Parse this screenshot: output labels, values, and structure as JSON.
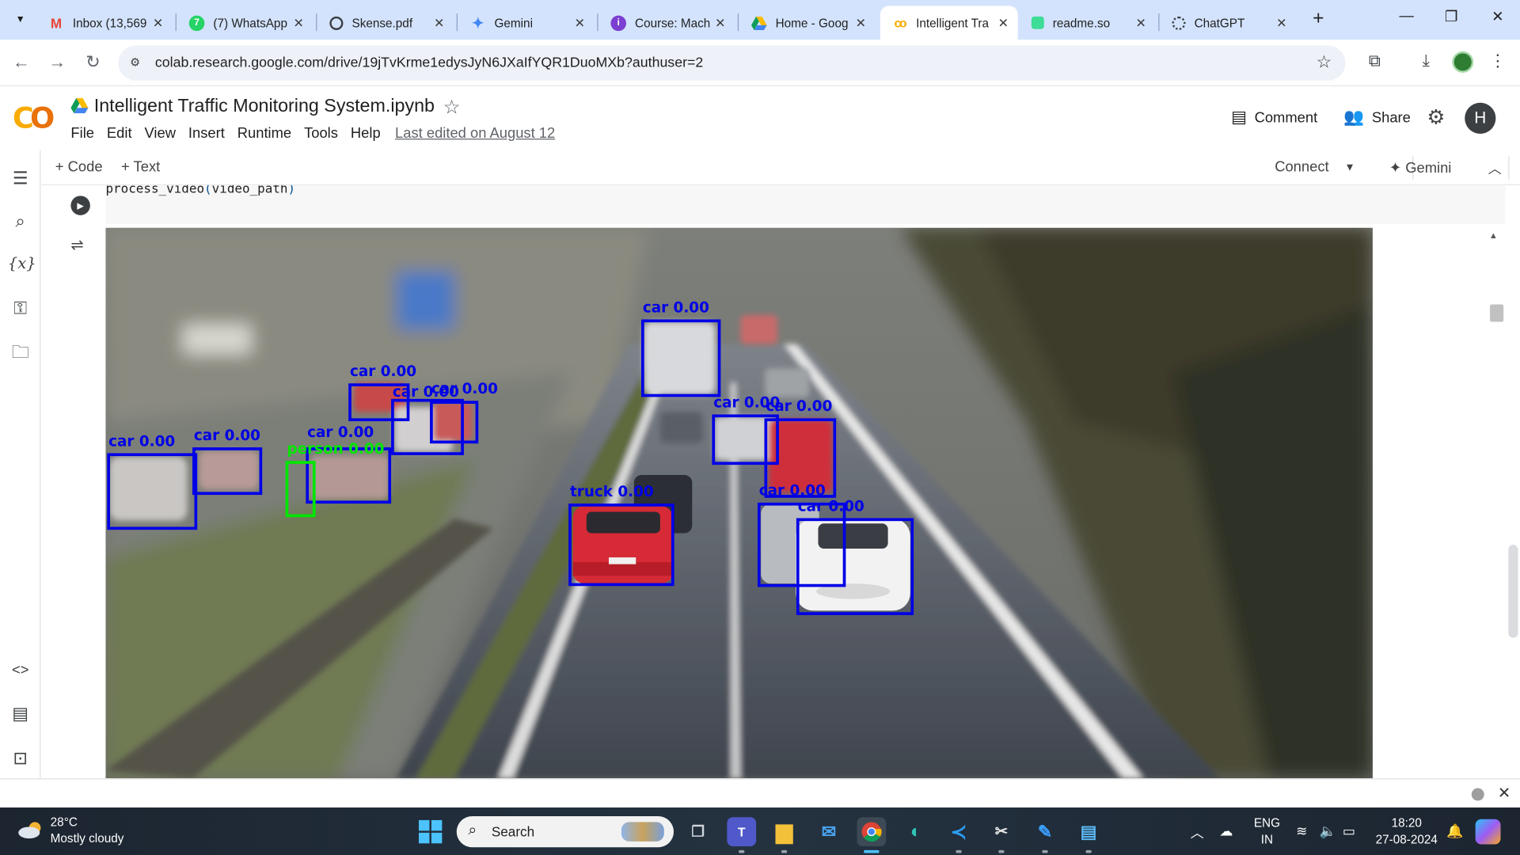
{
  "browser": {
    "tabs": [
      {
        "title": "Inbox (13,569",
        "icon": "gmail-icon",
        "active": false
      },
      {
        "title": "(7) WhatsApp",
        "icon": "whatsapp-icon",
        "active": false
      },
      {
        "title": "Skense.pdf",
        "icon": "globe-icon",
        "active": false
      },
      {
        "title": "Gemini",
        "icon": "gemini-icon",
        "active": false
      },
      {
        "title": "Course: Mach",
        "icon": "course-icon",
        "active": false
      },
      {
        "title": "Home - Goog",
        "icon": "drive-icon",
        "active": false
      },
      {
        "title": "Intelligent Tra",
        "icon": "colab-icon",
        "active": true
      },
      {
        "title": "readme.so",
        "icon": "readme-icon",
        "active": false
      },
      {
        "title": "ChatGPT",
        "icon": "chatgpt-icon",
        "active": false
      }
    ],
    "url": "colab.research.google.com/drive/19jTvKrme1edysJyN6JXaIfYQR1DuoMXb?authuser=2"
  },
  "colab": {
    "notebook_title": "Intelligent Traffic Monitoring System.ipynb",
    "menu": [
      "File",
      "Edit",
      "View",
      "Insert",
      "Runtime",
      "Tools",
      "Help"
    ],
    "last_edited": "Last edited on August 12",
    "comment_label": "Comment",
    "share_label": "Share",
    "avatar_letter": "H",
    "toolbar": {
      "code_label": "+ Code",
      "text_label": "+ Text",
      "connect_label": "Connect",
      "gemini_label": "Gemini"
    },
    "code_line": {
      "fn": "process_video",
      "arg": "video_path"
    }
  },
  "detections": [
    {
      "label": "car 0.00",
      "color": "#0000e6"
    },
    {
      "label": "car 0.00",
      "color": "#0000e6"
    },
    {
      "label": "car 0.00",
      "color": "#0000e6"
    },
    {
      "label": "car 0.00",
      "color": "#0000e6"
    },
    {
      "label": "car 0.00",
      "color": "#0000e6"
    },
    {
      "label": "car 0.00",
      "color": "#0000e6"
    },
    {
      "label": "car 0.00",
      "color": "#0000e6"
    },
    {
      "label": "person 0.00",
      "color": "#00e600"
    },
    {
      "label": "car 0.00",
      "color": "#0000e6"
    },
    {
      "label": "car 0.00",
      "color": "#0000e6"
    },
    {
      "label": "truck 0.00",
      "color": "#0000e6"
    },
    {
      "label": "car 0.00",
      "color": "#0000e6"
    },
    {
      "label": "car 0.00",
      "color": "#0000e6"
    }
  ],
  "taskbar": {
    "weather_temp": "28°C",
    "weather_desc": "Mostly cloudy",
    "search_placeholder": "Search",
    "lang_top": "ENG",
    "lang_bottom": "IN",
    "time": "18:20",
    "date": "27-08-2024"
  }
}
